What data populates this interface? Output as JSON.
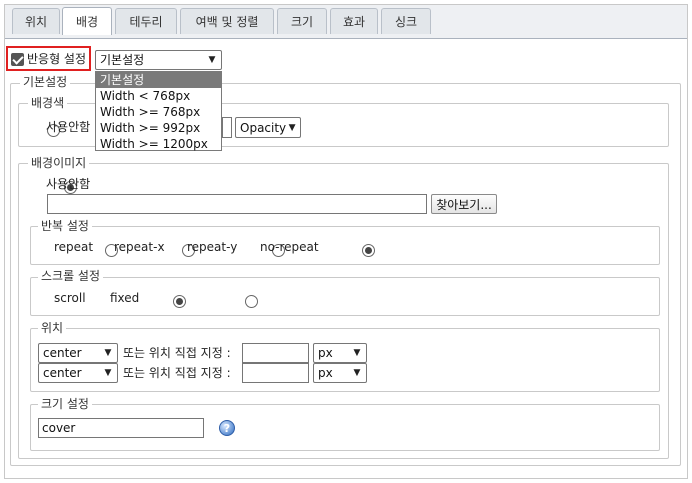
{
  "tabs": [
    {
      "label": "위치",
      "active": false
    },
    {
      "label": "배경",
      "active": true
    },
    {
      "label": "테두리",
      "active": false
    },
    {
      "label": "여백 및 정렬",
      "active": false
    },
    {
      "label": "크기",
      "active": false
    },
    {
      "label": "효과",
      "active": false
    },
    {
      "label": "싱크",
      "active": false
    }
  ],
  "responsive": {
    "checkbox_label": "반응형 설정",
    "checked": true,
    "select_value": "기본설정",
    "options": [
      "기본설정",
      "Width < 768px",
      "Width >= 768px",
      "Width >= 992px",
      "Width >= 1200px"
    ],
    "highlight_color": "#e02020"
  },
  "basic": {
    "legend": "기본설정",
    "bg_color": {
      "legend": "배경색",
      "radio_label": "사용안함",
      "opacity_select": "Opacity"
    },
    "bg_image": {
      "legend": "배경이미지",
      "none_label": "사용안함",
      "browse_button": "찾아보기...",
      "repeat": {
        "legend": "반복 설정",
        "options": [
          "repeat",
          "repeat-x",
          "repeat-y",
          "no-repeat"
        ],
        "selected": "no-repeat"
      },
      "scroll": {
        "legend": "스크롤 설정",
        "options": [
          "scroll",
          "fixed"
        ],
        "selected": "scroll"
      },
      "position": {
        "legend": "위치",
        "rows": [
          {
            "select": "center",
            "text": "또는 위치 직접 지정 :",
            "unit": "px"
          },
          {
            "select": "center",
            "text": "또는 위치 직접 지정 :",
            "unit": "px"
          }
        ]
      },
      "size": {
        "legend": "크기 설정",
        "value": "cover",
        "help_icon": "help-icon"
      }
    }
  }
}
